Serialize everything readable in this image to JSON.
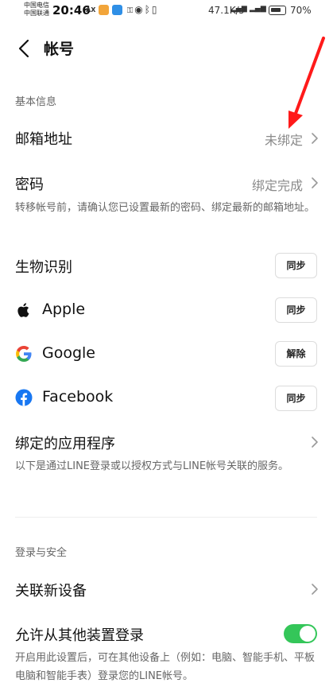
{
  "status_bar": {
    "carrier_1": "中国电信",
    "carrier_2": "中国联通",
    "time": "20:46",
    "ax_label": "AX",
    "network_speed": "47.1K/s",
    "battery": "70%"
  },
  "header": {
    "title": "帐号"
  },
  "basic_info": {
    "section_label": "基本信息",
    "email": {
      "label": "邮箱地址",
      "value": "未绑定"
    },
    "password": {
      "label": "密码",
      "value": "绑定完成"
    },
    "password_note": "转移帐号前，请确认您已设置最新的密码、绑定最新的邮箱地址。",
    "biometrics": {
      "label": "生物识别",
      "button": "同步"
    },
    "apple": {
      "label": "Apple",
      "button": "同步"
    },
    "google": {
      "label": "Google",
      "button": "解除"
    },
    "facebook": {
      "label": "Facebook",
      "button": "同步"
    },
    "linked_apps": {
      "label": "绑定的应用程序"
    },
    "linked_apps_note": "以下是通过LINE登录或以授权方式与LINE帐号关联的服务。"
  },
  "login_security": {
    "section_label": "登录与安全",
    "link_device": {
      "label": "关联新设备"
    },
    "allow_other_login": {
      "label": "允许从其他装置登录",
      "enabled": true
    },
    "allow_other_login_note": "开启用此设置后，可在其他设备上（例如：电脑、智能手机、平板电脑和智能手表）登录您的LINE帐号。"
  },
  "colors": {
    "accent_toggle": "#34c659",
    "annotation_arrow": "#ff1a1a",
    "facebook_blue": "#1877f2"
  }
}
